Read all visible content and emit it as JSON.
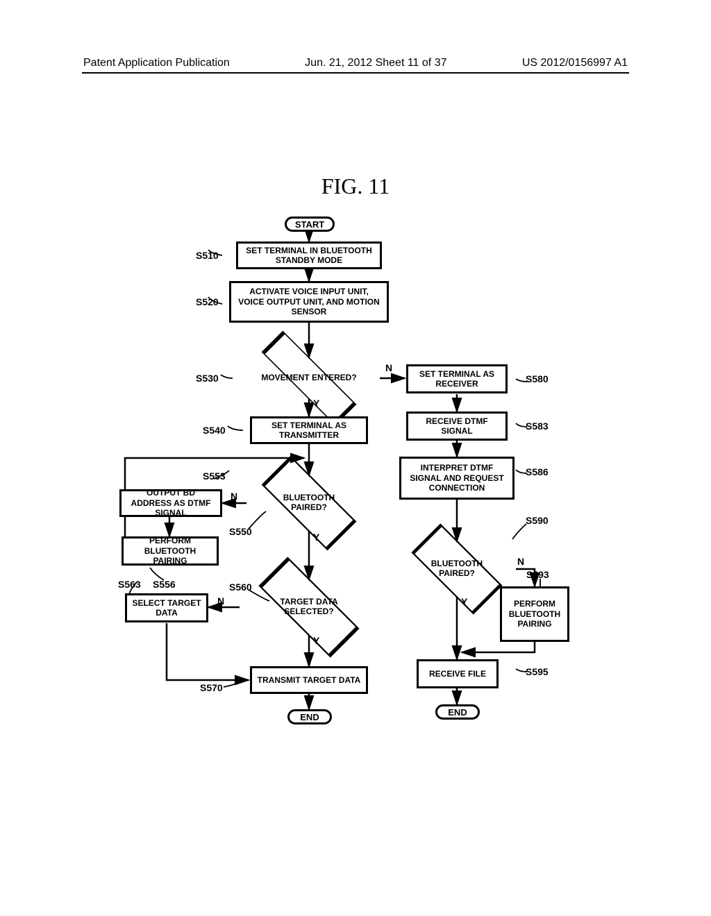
{
  "header": {
    "left": "Patent Application Publication",
    "center": "Jun. 21, 2012  Sheet 11 of 37",
    "right": "US 2012/0156997 A1"
  },
  "figure_title": "FIG.  11",
  "nodes": {
    "start": "START",
    "s510": "SET TERMINAL IN BLUETOOTH STANDBY MODE",
    "s520": "ACTIVATE VOICE INPUT UNIT, VOICE OUTPUT UNIT, AND MOTION SENSOR",
    "s530": "MOVEMENT ENTERED?",
    "s540": "SET TERMINAL AS TRANSMITTER",
    "s550": "BLUETOOTH PAIRED?",
    "s553": "OUTPUT BD ADDRESS AS DTMF SIGNAL",
    "s556": "PERFORM BLUETOOTH PAIRING",
    "s560": "TARGET DATA SELECTED?",
    "s563": "SELECT TARGET DATA",
    "s570": "TRANSMIT TARGET DATA",
    "s580": "SET TERMINAL AS RECEIVER",
    "s583": "RECEIVE DTMF SIGNAL",
    "s586": "INTERPRET DTMF SIGNAL AND REQUEST CONNECTION",
    "s590": "BLUETOOTH PAIRED?",
    "s593": "PERFORM BLUETOOTH PAIRING",
    "s595": "RECEIVE FILE",
    "end1": "END",
    "end2": "END"
  },
  "labels": {
    "s510": "S510",
    "s520": "S520",
    "s530": "S530",
    "s540": "S540",
    "s550": "S550",
    "s553": "S553",
    "s556": "S556",
    "s560": "S560",
    "s563": "S563",
    "s570": "S570",
    "s580": "S580",
    "s583": "S583",
    "s586": "S586",
    "s590": "S590",
    "s593": "S593",
    "s595": "S595"
  },
  "branches": {
    "y": "Y",
    "n": "N"
  }
}
